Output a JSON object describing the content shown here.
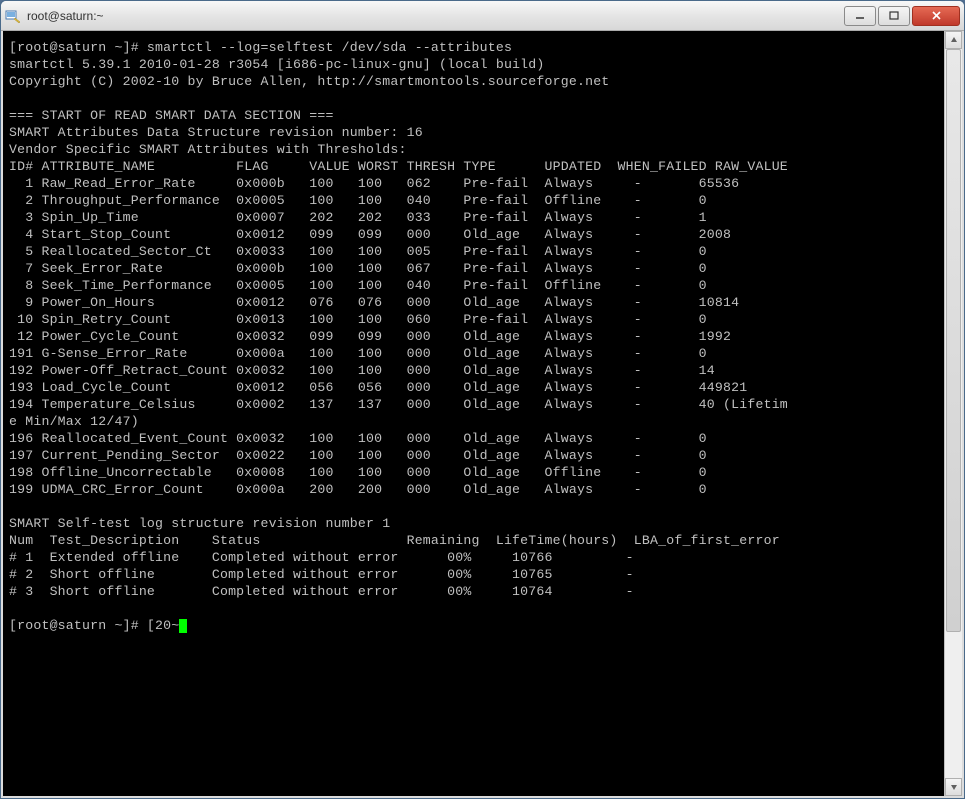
{
  "window": {
    "title": "root@saturn:~"
  },
  "prompt1": "[root@saturn ~]# ",
  "command": "smartctl --log=selftest /dev/sda --attributes",
  "header1": "smartctl 5.39.1 2010-01-28 r3054 [i686-pc-linux-gnu] (local build)",
  "header2": "Copyright (C) 2002-10 by Bruce Allen, http://smartmontools.sourceforge.net",
  "section": "=== START OF READ SMART DATA SECTION ===",
  "attr_header1": "SMART Attributes Data Structure revision number: 16",
  "attr_header2": "Vendor Specific SMART Attributes with Thresholds:",
  "attr_cols": "ID# ATTRIBUTE_NAME          FLAG     VALUE WORST THRESH TYPE      UPDATED  WHEN_FAILED RAW_VALUE",
  "attributes": [
    {
      "id": "  1",
      "name": "Raw_Read_Error_Rate    ",
      "flag": "0x000b",
      "value": "100",
      "worst": "100",
      "thresh": "062",
      "type": "Pre-fail",
      "updated": "Always ",
      "failed": "-",
      "raw": "65536"
    },
    {
      "id": "  2",
      "name": "Throughput_Performance ",
      "flag": "0x0005",
      "value": "100",
      "worst": "100",
      "thresh": "040",
      "type": "Pre-fail",
      "updated": "Offline",
      "failed": "-",
      "raw": "0"
    },
    {
      "id": "  3",
      "name": "Spin_Up_Time           ",
      "flag": "0x0007",
      "value": "202",
      "worst": "202",
      "thresh": "033",
      "type": "Pre-fail",
      "updated": "Always ",
      "failed": "-",
      "raw": "1"
    },
    {
      "id": "  4",
      "name": "Start_Stop_Count       ",
      "flag": "0x0012",
      "value": "099",
      "worst": "099",
      "thresh": "000",
      "type": "Old_age ",
      "updated": "Always ",
      "failed": "-",
      "raw": "2008"
    },
    {
      "id": "  5",
      "name": "Reallocated_Sector_Ct  ",
      "flag": "0x0033",
      "value": "100",
      "worst": "100",
      "thresh": "005",
      "type": "Pre-fail",
      "updated": "Always ",
      "failed": "-",
      "raw": "0"
    },
    {
      "id": "  7",
      "name": "Seek_Error_Rate        ",
      "flag": "0x000b",
      "value": "100",
      "worst": "100",
      "thresh": "067",
      "type": "Pre-fail",
      "updated": "Always ",
      "failed": "-",
      "raw": "0"
    },
    {
      "id": "  8",
      "name": "Seek_Time_Performance  ",
      "flag": "0x0005",
      "value": "100",
      "worst": "100",
      "thresh": "040",
      "type": "Pre-fail",
      "updated": "Offline",
      "failed": "-",
      "raw": "0"
    },
    {
      "id": "  9",
      "name": "Power_On_Hours         ",
      "flag": "0x0012",
      "value": "076",
      "worst": "076",
      "thresh": "000",
      "type": "Old_age ",
      "updated": "Always ",
      "failed": "-",
      "raw": "10814"
    },
    {
      "id": " 10",
      "name": "Spin_Retry_Count       ",
      "flag": "0x0013",
      "value": "100",
      "worst": "100",
      "thresh": "060",
      "type": "Pre-fail",
      "updated": "Always ",
      "failed": "-",
      "raw": "0"
    },
    {
      "id": " 12",
      "name": "Power_Cycle_Count      ",
      "flag": "0x0032",
      "value": "099",
      "worst": "099",
      "thresh": "000",
      "type": "Old_age ",
      "updated": "Always ",
      "failed": "-",
      "raw": "1992"
    },
    {
      "id": "191",
      "name": "G-Sense_Error_Rate     ",
      "flag": "0x000a",
      "value": "100",
      "worst": "100",
      "thresh": "000",
      "type": "Old_age ",
      "updated": "Always ",
      "failed": "-",
      "raw": "0"
    },
    {
      "id": "192",
      "name": "Power-Off_Retract_Count",
      "flag": "0x0032",
      "value": "100",
      "worst": "100",
      "thresh": "000",
      "type": "Old_age ",
      "updated": "Always ",
      "failed": "-",
      "raw": "14"
    },
    {
      "id": "193",
      "name": "Load_Cycle_Count       ",
      "flag": "0x0012",
      "value": "056",
      "worst": "056",
      "thresh": "000",
      "type": "Old_age ",
      "updated": "Always ",
      "failed": "-",
      "raw": "449821"
    },
    {
      "id": "194",
      "name": "Temperature_Celsius    ",
      "flag": "0x0002",
      "value": "137",
      "worst": "137",
      "thresh": "000",
      "type": "Old_age ",
      "updated": "Always ",
      "failed": "-",
      "raw": "40 (Lifetim"
    }
  ],
  "attr_wrap": "e Min/Max 12/47)",
  "attributes2": [
    {
      "id": "196",
      "name": "Reallocated_Event_Count",
      "flag": "0x0032",
      "value": "100",
      "worst": "100",
      "thresh": "000",
      "type": "Old_age ",
      "updated": "Always ",
      "failed": "-",
      "raw": "0"
    },
    {
      "id": "197",
      "name": "Current_Pending_Sector ",
      "flag": "0x0022",
      "value": "100",
      "worst": "100",
      "thresh": "000",
      "type": "Old_age ",
      "updated": "Always ",
      "failed": "-",
      "raw": "0"
    },
    {
      "id": "198",
      "name": "Offline_Uncorrectable  ",
      "flag": "0x0008",
      "value": "100",
      "worst": "100",
      "thresh": "000",
      "type": "Old_age ",
      "updated": "Offline",
      "failed": "-",
      "raw": "0"
    },
    {
      "id": "199",
      "name": "UDMA_CRC_Error_Count   ",
      "flag": "0x000a",
      "value": "200",
      "worst": "200",
      "thresh": "000",
      "type": "Old_age ",
      "updated": "Always ",
      "failed": "-",
      "raw": "0"
    }
  ],
  "selftest_header": "SMART Self-test log structure revision number 1",
  "selftest_cols": "Num  Test_Description    Status                  Remaining  LifeTime(hours)  LBA_of_first_error",
  "selftests": [
    {
      "num": "# 1",
      "desc": "Extended offline   ",
      "status": "Completed without error",
      "remaining": "00%",
      "lifetime": "10766",
      "lba": "-"
    },
    {
      "num": "# 2",
      "desc": "Short offline      ",
      "status": "Completed without error",
      "remaining": "00%",
      "lifetime": "10765",
      "lba": "-"
    },
    {
      "num": "# 3",
      "desc": "Short offline      ",
      "status": "Completed without error",
      "remaining": "00%",
      "lifetime": "10764",
      "lba": "-"
    }
  ],
  "prompt2": "[root@saturn ~]# [20~"
}
